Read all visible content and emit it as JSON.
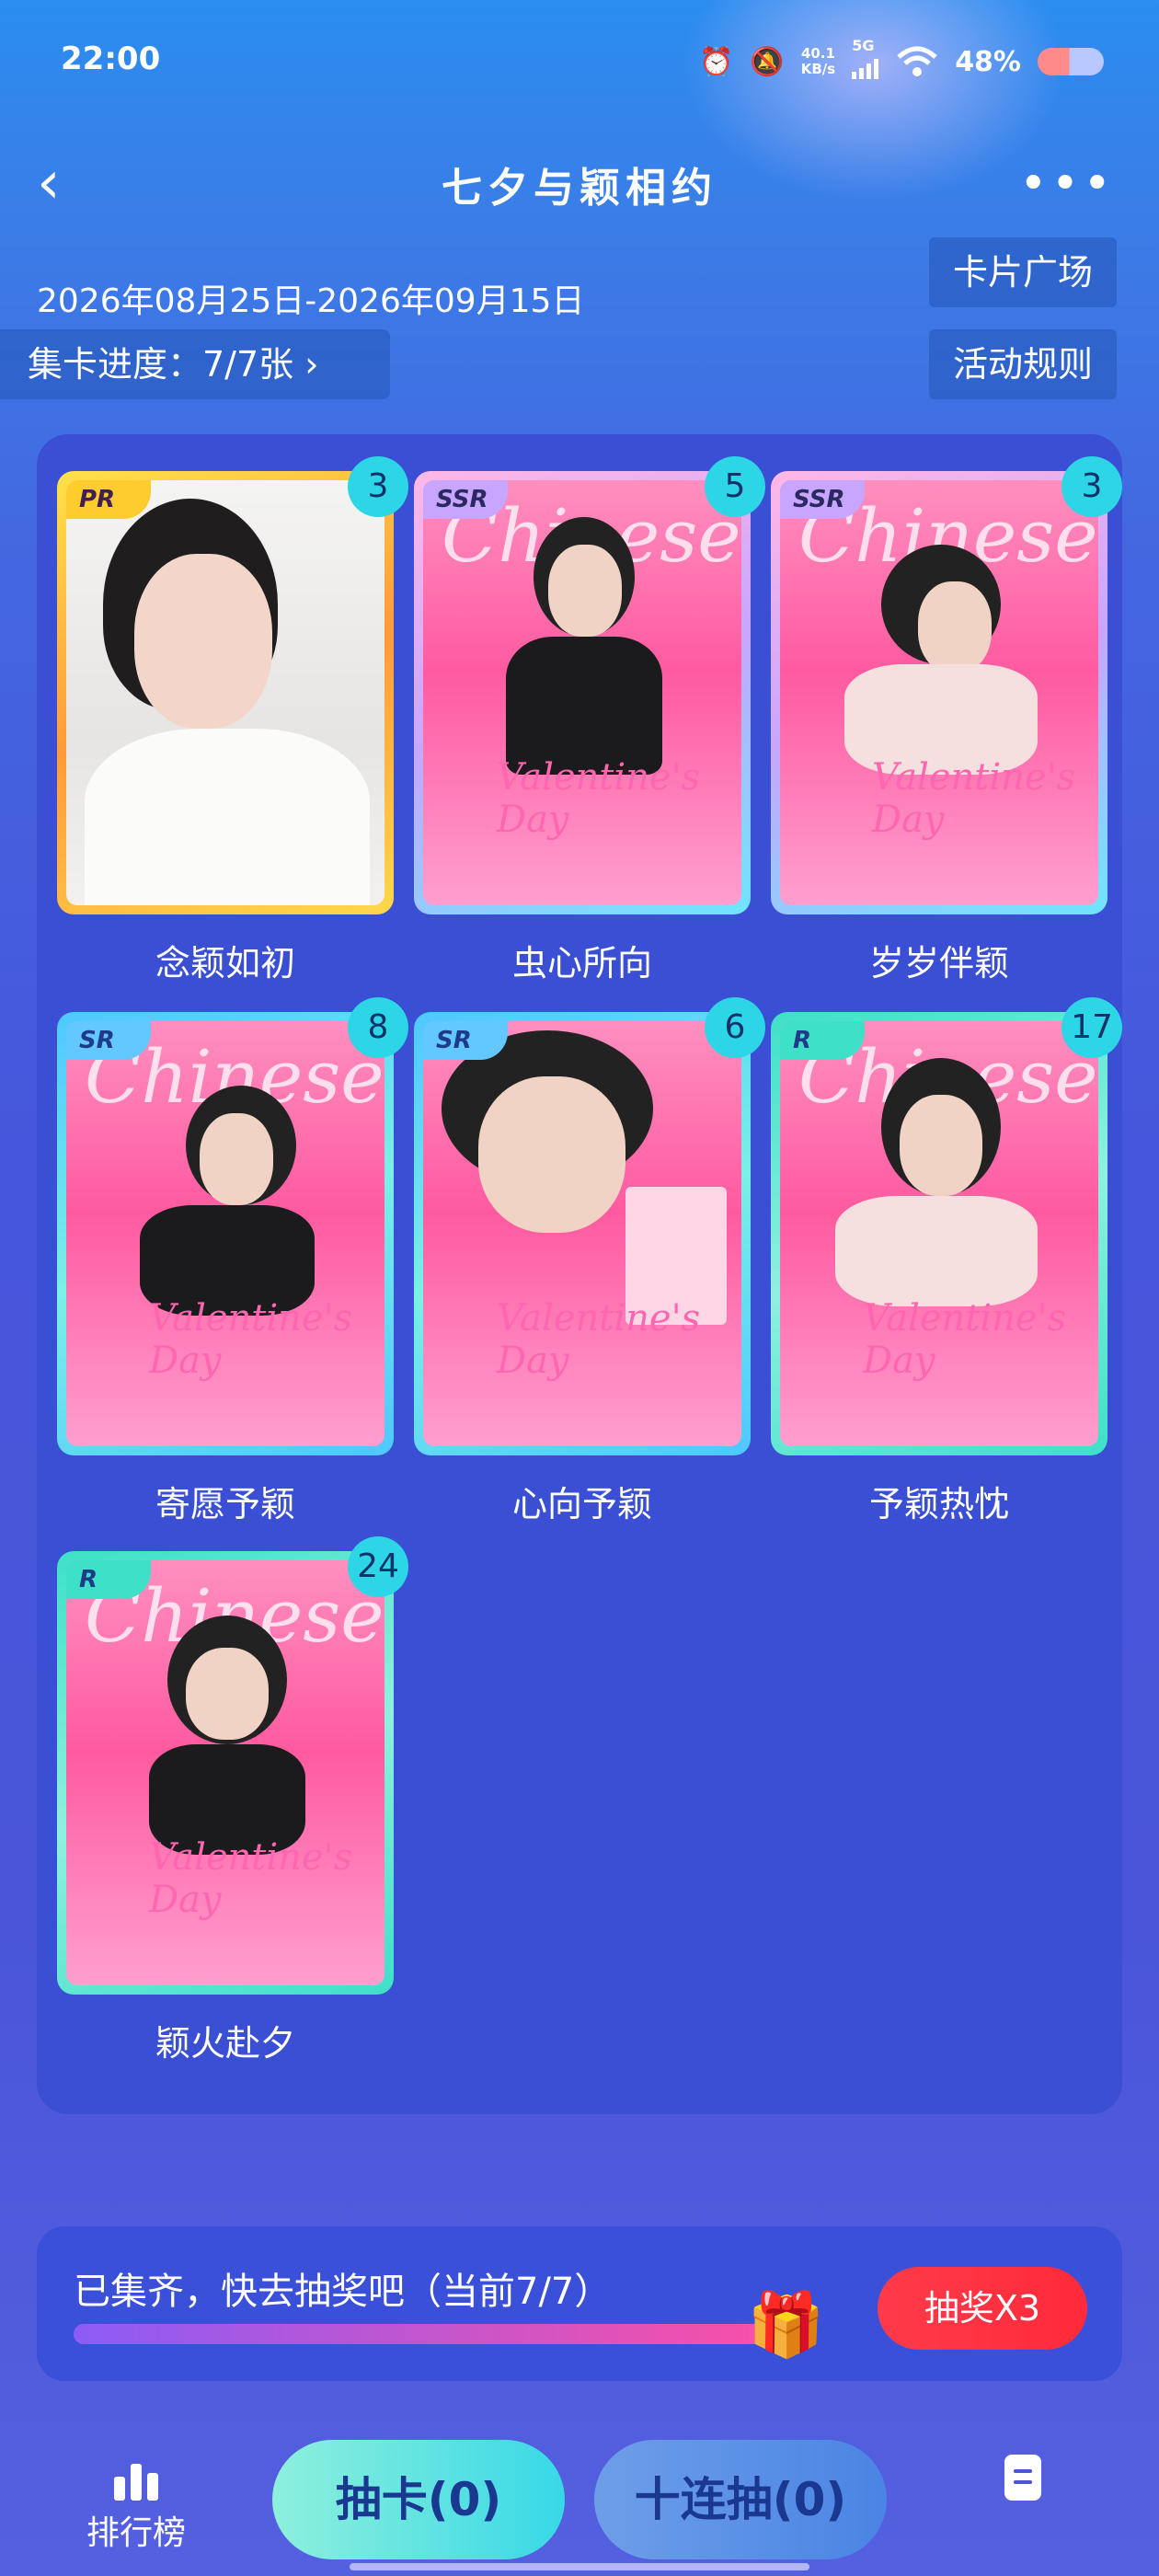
{
  "status": {
    "time": "22:00",
    "net_speed_value": "40.1",
    "net_speed_unit": "KB/s",
    "network": "5G",
    "battery": "48%"
  },
  "header": {
    "title": "七夕与颖相约"
  },
  "event": {
    "date_range": "2026年08月25日-2026年09月15日",
    "card_square": "卡片广场",
    "rules": "活动规则",
    "progress": "集卡进度：7/7张 ›"
  },
  "cards": [
    {
      "name": "念颖如初",
      "rarity": "PR",
      "count": "3",
      "color": "#ffcc30"
    },
    {
      "name": "虫心所向",
      "rarity": "SSR",
      "count": "5",
      "color": "#c8a6ff"
    },
    {
      "name": "岁岁伴颖",
      "rarity": "SSR",
      "count": "3",
      "color": "#c8a6ff"
    },
    {
      "name": "寄愿予颖",
      "rarity": "SR",
      "count": "8",
      "color": "#62c8ff"
    },
    {
      "name": "心向予颖",
      "rarity": "SR",
      "count": "6",
      "color": "#62c8ff"
    },
    {
      "name": "予颖热忱",
      "rarity": "R",
      "count": "17",
      "color": "#3ee0c8"
    },
    {
      "name": "颖火赴夕",
      "rarity": "R",
      "count": "24",
      "color": "#3ee0c8"
    }
  ],
  "lottery": {
    "text": "已集齐，快去抽奖吧（当前7/7）",
    "progress": 1.0,
    "button": "抽奖X3"
  },
  "nav": {
    "rank": "排行榜",
    "draw_one": "抽卡(0)",
    "draw_ten": "十连抽(0)"
  }
}
